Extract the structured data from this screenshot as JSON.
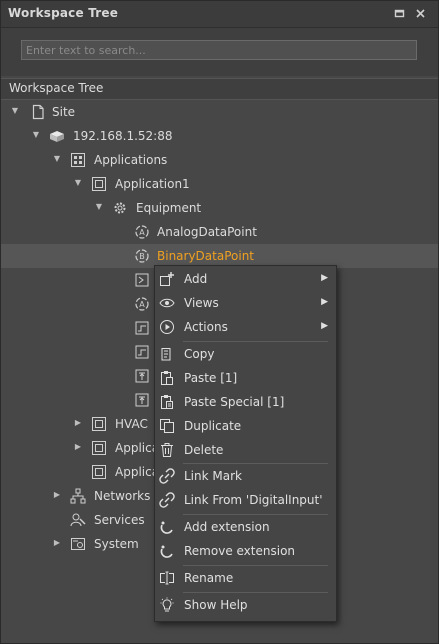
{
  "panel": {
    "title": "Workspace Tree",
    "restore_icon": "restore-icon",
    "close_icon": "close-icon"
  },
  "search": {
    "placeholder": "Enter text to search..."
  },
  "section": {
    "label": "Workspace Tree"
  },
  "tree": {
    "site": "Site",
    "ip": "192.168.1.52:88",
    "applications": "Applications",
    "application1": "Application1",
    "equipment": "Equipment",
    "analog": "AnalogDataPoint",
    "binary": "BinaryDataPoint",
    "hvac": "HVAC",
    "applica1": "Applica",
    "applica2": "Applica",
    "networks": "Networks",
    "services": "Services",
    "system": "System"
  },
  "menu": {
    "add": "Add",
    "views": "Views",
    "actions": "Actions",
    "copy": "Copy",
    "paste": "Paste [1]",
    "paste_special": "Paste Special [1]",
    "duplicate": "Duplicate",
    "delete": "Delete",
    "link_mark": "Link Mark",
    "link_from": "Link From 'DigitalInput'",
    "add_extension": "Add extension",
    "remove_extension": "Remove extension",
    "rename": "Rename",
    "show_help": "Show Help"
  },
  "colors": {
    "selected_text": "#f0a020",
    "background": "#474747",
    "menu_bg": "#454545"
  }
}
